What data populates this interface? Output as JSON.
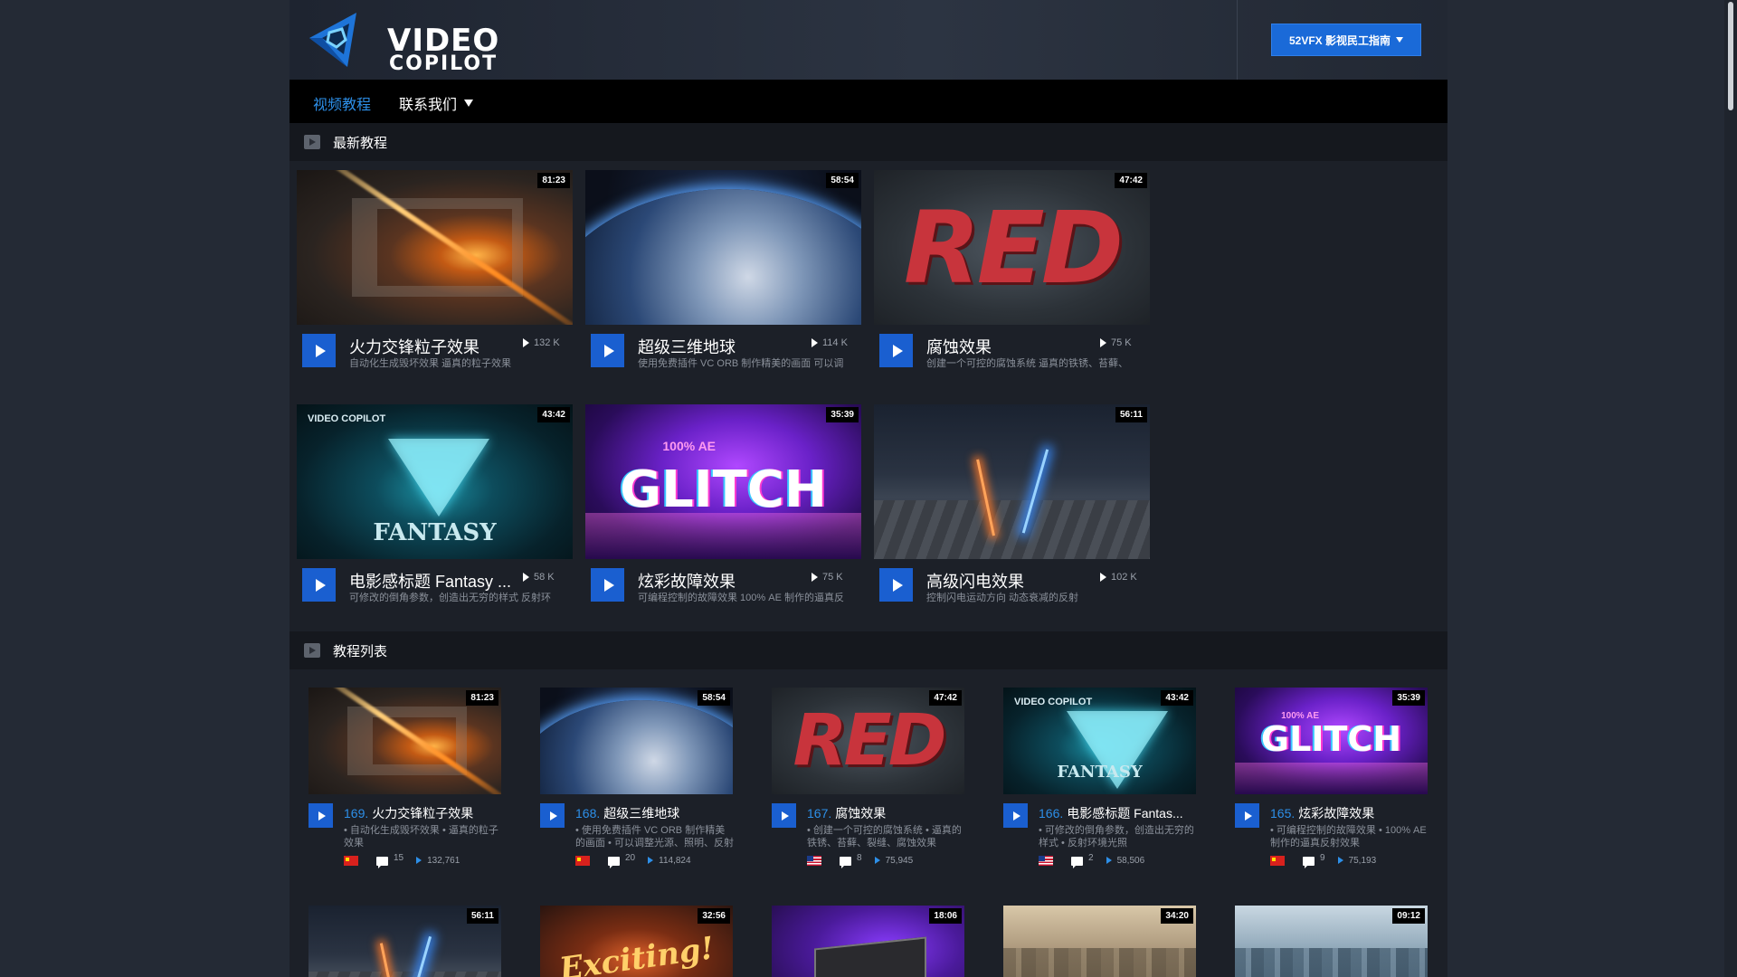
{
  "header": {
    "logo_line1": "VIDEO",
    "logo_line2": "COPILOT",
    "guide_button": "52VFX 影视民工指南"
  },
  "nav": {
    "tutorials": "视频教程",
    "contact": "联系我们"
  },
  "sections": {
    "latest": "最新教程",
    "list": "教程列表"
  },
  "featured": [
    {
      "title": "火力交锋粒子效果",
      "duration": "81:23",
      "views": "132 K",
      "desc": "自动化生成毁坏效果 逼真的粒子效果",
      "art": "fire"
    },
    {
      "title": "超级三维地球",
      "duration": "58:54",
      "views": "114 K",
      "desc": "使用免费插件 VC ORB 制作精美的画面 可以调",
      "art": "earth"
    },
    {
      "title": "腐蚀效果",
      "duration": "47:42",
      "views": "75 K",
      "desc": "创建一个可控的腐蚀系统 逼真的铁锈、苔藓、",
      "art": "red",
      "art_text": "RED"
    },
    {
      "title": "电影感标题 Fantasy ...",
      "duration": "43:42",
      "views": "58 K",
      "desc": "可修改的倒角参数，创造出无穷的样式 反射环",
      "art": "fantasy",
      "art_text": "FANTASY",
      "art_mini": "VIDEO COPILOT"
    },
    {
      "title": "炫彩故障效果",
      "duration": "35:39",
      "views": "75 K",
      "desc": "可编程控制的故障效果 100% AE 制作的逼真反",
      "art": "glitch",
      "art_text": "GLITCH",
      "art_pre": "100% AE"
    },
    {
      "title": "高级闪电效果",
      "duration": "56:11",
      "views": "102 K",
      "desc": "控制闪电运动方向 动态衰减的反射",
      "art": "lightning"
    }
  ],
  "list": [
    {
      "num": "169.",
      "title": "火力交锋粒子效果",
      "duration": "81:23",
      "desc": "• 自动化生成毁坏效果 • 逼真的粒子效果",
      "flag": "cn",
      "comments": "15",
      "views": "132,761",
      "art": "fire"
    },
    {
      "num": "168.",
      "title": "超级三维地球",
      "duration": "58:54",
      "desc": "• 使用免费插件 VC ORB 制作精美的画面 • 可以调整光源、照明、反射以",
      "flag": "cn",
      "comments": "20",
      "views": "114,824",
      "art": "earth"
    },
    {
      "num": "167.",
      "title": "腐蚀效果",
      "duration": "47:42",
      "desc": "• 创建一个可控的腐蚀系统 • 逼真的铁锈、苔藓、裂缝、腐蚀效果",
      "flag": "us",
      "comments": "8",
      "views": "75,945",
      "art": "red",
      "art_text": "RED"
    },
    {
      "num": "166.",
      "title": "电影感标题 Fantas...",
      "duration": "43:42",
      "desc": "• 可修改的倒角参数，创造出无穷的样式 • 反射环境光照",
      "flag": "us",
      "comments": "2",
      "views": "58,506",
      "art": "fantasy",
      "art_text": "FANTASY",
      "art_mini": "VIDEO COPILOT"
    },
    {
      "num": "165.",
      "title": "炫彩故障效果",
      "duration": "35:39",
      "desc": "• 可编程控制的故障效果 • 100% AE 制作的逼真反射效果",
      "flag": "cn",
      "comments": "9",
      "views": "75,193",
      "art": "glitch",
      "art_text": "GLITCH",
      "art_pre": "100% AE"
    }
  ],
  "list_row2": [
    {
      "duration": "56:11",
      "art": "lightning"
    },
    {
      "duration": "32:56",
      "art": "exciting",
      "art_text": "Exciting!"
    },
    {
      "duration": "18:06",
      "art": "device"
    },
    {
      "duration": "34:20",
      "art": "city"
    },
    {
      "duration": "09:12",
      "art": "city2"
    }
  ]
}
